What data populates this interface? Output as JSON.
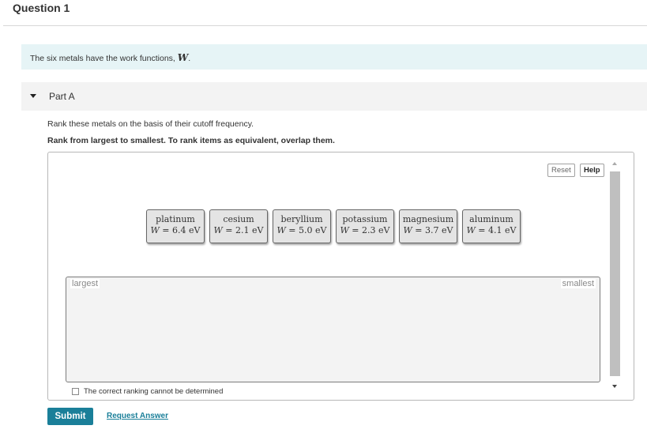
{
  "question": {
    "title": "Question 1"
  },
  "intro": {
    "text": "The six metals have the work functions, ",
    "variable": "W",
    "suffix": "."
  },
  "part": {
    "label": "Part A"
  },
  "instructions": {
    "line1": "Rank these metals on the basis of their cutoff frequency.",
    "line2": "Rank from largest to smallest. To rank items as equivalent, overlap them."
  },
  "toolbar": {
    "reset_label": "Reset",
    "help_label": "Help"
  },
  "tiles": [
    {
      "name": "platinum",
      "var": "W",
      "value": "6.4 eV"
    },
    {
      "name": "cesium",
      "var": "W",
      "value": "2.1 eV"
    },
    {
      "name": "beryllium",
      "var": "W",
      "value": "5.0 eV"
    },
    {
      "name": "potassium",
      "var": "W",
      "value": "2.3 eV"
    },
    {
      "name": "magnesium",
      "var": "W",
      "value": "3.7 eV"
    },
    {
      "name": "aluminum",
      "var": "W",
      "value": "4.1 eV"
    }
  ],
  "ranking": {
    "largest_label": "largest",
    "smallest_label": "smallest"
  },
  "cannot_determine": {
    "label": "The correct ranking cannot be determined",
    "checked": false
  },
  "actions": {
    "submit_label": "Submit",
    "request_label": "Request Answer"
  },
  "colors": {
    "accent": "#1a7f99",
    "intro_bg": "#e6f4f6",
    "tile_bg": "#e4e4e4"
  }
}
